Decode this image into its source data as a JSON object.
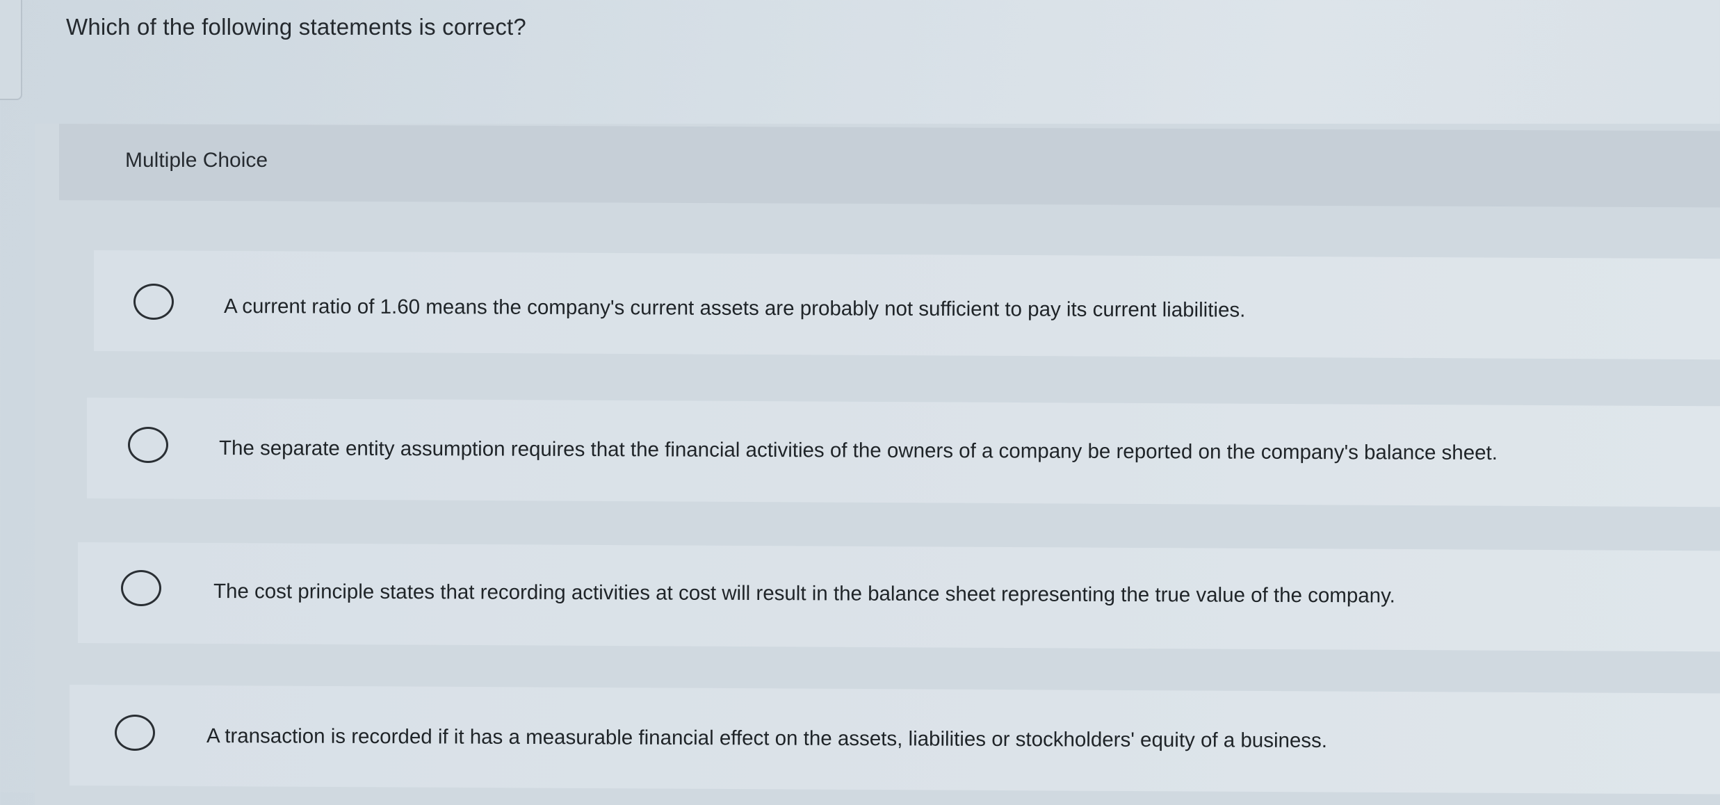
{
  "question": {
    "text": "Which of the following statements is correct?"
  },
  "section": {
    "label": "Multiple Choice"
  },
  "options": [
    {
      "text": "A current ratio of 1.60 means the company's current assets are probably not sufficient to pay its current liabilities.",
      "selected": false
    },
    {
      "text": "The separate entity assumption requires that the financial activities of the owners of a company be reported on the company's balance sheet.",
      "selected": false
    },
    {
      "text": "The cost principle states that recording activities at cost will result in the balance sheet representing the true value of the company.",
      "selected": false
    },
    {
      "text": "A transaction is recorded if it has a measurable financial effect on the assets, liabilities or stockholders' equity of a business.",
      "selected": false
    }
  ]
}
